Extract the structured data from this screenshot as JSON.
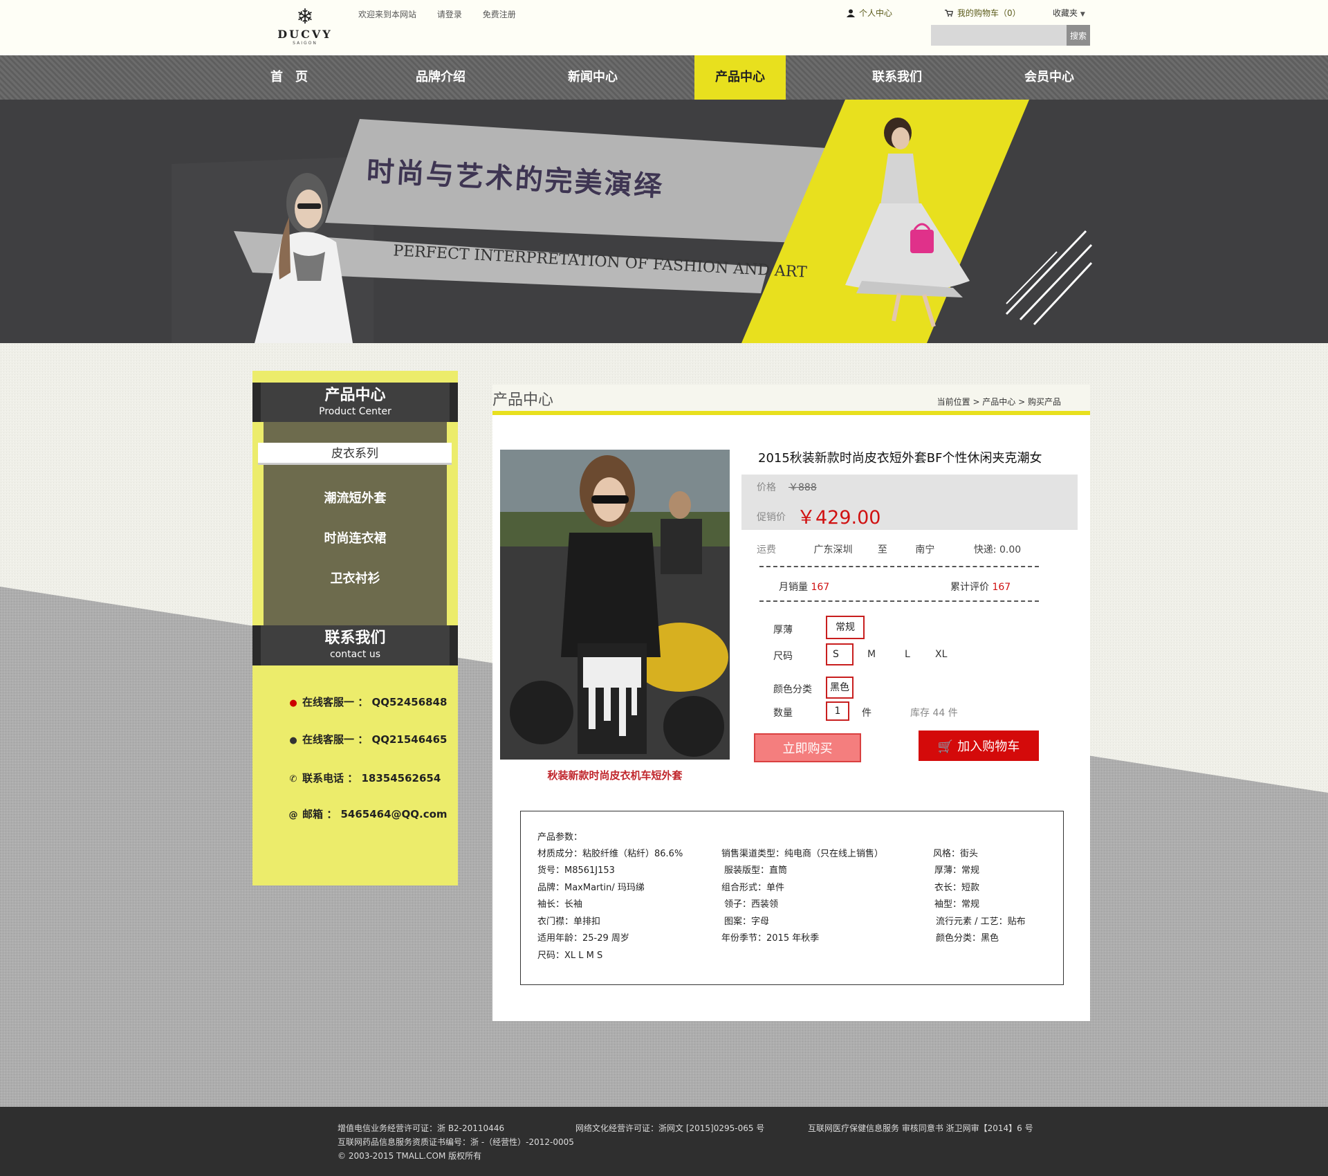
{
  "header": {
    "logo": {
      "brand": "DUCVY",
      "sub": "SAIGON"
    },
    "links": [
      "欢迎来到本网站",
      "请登录",
      "免费注册"
    ],
    "user_center": "个人中心",
    "cart": "我的购物车（0）",
    "favorites": "收藏夹",
    "search_button": "搜索",
    "search_placeholder": ""
  },
  "nav": {
    "items": [
      {
        "label": "首　页"
      },
      {
        "label": "品牌介绍"
      },
      {
        "label": "新闻中心"
      },
      {
        "label": "产品中心"
      },
      {
        "label": "联系我们"
      },
      {
        "label": "会员中心"
      }
    ],
    "active": "产品中心",
    "active_color": "#e8e01e"
  },
  "banner": {
    "title": "时尚与艺术的完美演绎",
    "subtitle": "PERFECT INTERPRETATION OF FASHION AND ART",
    "accent_color": "#e8e01e"
  },
  "sidebar": {
    "product_center": {
      "cn": "产品中心",
      "en": "Product Center"
    },
    "category": "皮衣系列",
    "items": [
      "潮流短外套",
      "时尚连衣裙",
      "卫衣衬衫"
    ],
    "contact": {
      "cn": "联系我们",
      "en": "contact us"
    },
    "contacts": [
      {
        "icon": "qq-icon",
        "text": "在线客服一 ： QQ52456848"
      },
      {
        "icon": "qq-icon",
        "text": "在线客服一 ： QQ21546465"
      },
      {
        "icon": "phone-icon",
        "text": "联系电话 ： 18354562654"
      },
      {
        "icon": "at-icon",
        "text": "邮箱 ： 5465464@QQ.com"
      }
    ]
  },
  "content": {
    "title": "产品中心",
    "breadcrumb": "当前位置 > 产品中心 > 购买产品",
    "product": {
      "caption": "秋装新款时尚皮衣机车短外套",
      "name": "2015秋装新款时尚皮衣短外套BF个性休闲夹克潮女",
      "price_label": "价格",
      "price_old": "￥888",
      "sale_label": "促销价",
      "price_now": "￥429.00",
      "shipping": {
        "label": "运费",
        "from": "广东深圳",
        "to_word": "至",
        "to": "南宁",
        "express": "快递: 0.00"
      },
      "monthly_sales_label": "月销量",
      "monthly_sales": "167",
      "reviews_label": "累计评价",
      "reviews": "167",
      "thickness_label": "厚薄",
      "thickness": "常规",
      "size_label": "尺码",
      "sizes": [
        "S",
        "M",
        "L",
        "XL"
      ],
      "selected_size": "S",
      "color_label": "颜色分类",
      "color": "黑色",
      "qty_label": "数量",
      "qty": "1",
      "qty_unit": "件",
      "stock": "库存 44 件",
      "buy_now": "立即购买",
      "add_cart": "加入购物车"
    },
    "params": {
      "title": "产品参数：",
      "col1": [
        "材质成分：粘胶纤维（粘纤）86.6%",
        "货号：M8561J153",
        "品牌：MaxMartin/ 玛玛绨",
        "袖长：长袖",
        "衣门襟：单排扣",
        "适用年龄：25-29 周岁",
        "尺码：XL L M S"
      ],
      "col2": [
        "销售渠道类型：纯电商（只在线上销售）",
        "服装版型：直筒",
        "组合形式：单件",
        "领子：西装领",
        "图案：字母",
        "年份季节：2015 年秋季"
      ],
      "col3": [
        "风格：街头",
        "厚薄：常规",
        "衣长：短款",
        "袖型：常规",
        "流行元素 / 工艺：贴布",
        "颜色分类：黑色"
      ]
    }
  },
  "footer": {
    "line1a": "增值电信业务经营许可证：浙 B2-20110446",
    "line1b": "网络文化经营许可证：浙网文 [2015]0295-065 号",
    "line1c": "互联网医疗保健信息服务 审核同意书 浙卫网审【2014】6 号",
    "line2": "互联网药品信息服务资质证书编号：浙 -（经营性）-2012-0005",
    "line3": "© 2003-2015 TMALL.COM 版权所有"
  }
}
